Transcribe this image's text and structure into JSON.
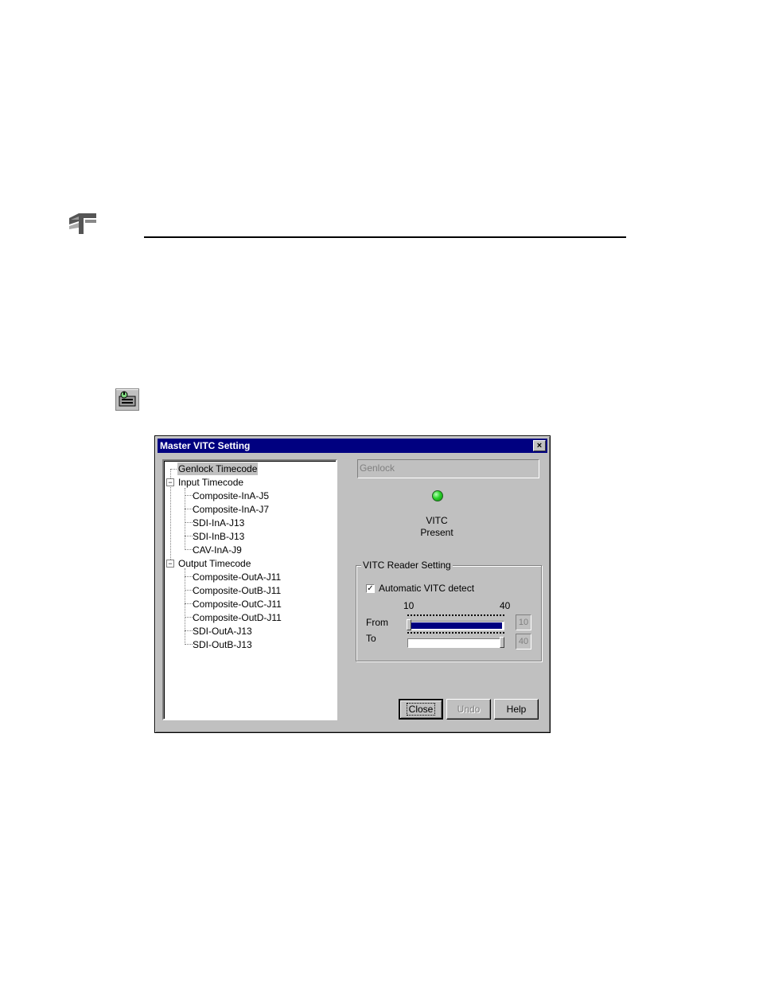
{
  "dialog": {
    "title": "Master VITC Setting",
    "close_glyph": "×",
    "source_field": "Genlock",
    "status_line1": "VITC",
    "status_line2": "Present",
    "led_color": "#2ad42a"
  },
  "tree": {
    "root_item": "Genlock Timecode",
    "input_group": "Input Timecode",
    "input_items": [
      "Composite-InA-J5",
      "Composite-InA-J7",
      "SDI-InA-J13",
      "SDI-InB-J13",
      "CAV-InA-J9"
    ],
    "output_group": "Output Timecode",
    "output_items": [
      "Composite-OutA-J11",
      "Composite-OutB-J11",
      "Composite-OutC-J11",
      "Composite-OutD-J11",
      "SDI-OutA-J13",
      "SDI-OutB-J13"
    ],
    "collapse_glyph": "−"
  },
  "reader": {
    "group_label": "VITC Reader Setting",
    "auto_detect_label": "Automatic VITC detect",
    "auto_detect_checked": "✓",
    "min_label": "10",
    "max_label": "40",
    "from_label": "From",
    "to_label": "To",
    "from_value": "10",
    "to_value": "40"
  },
  "buttons": {
    "close": "Close",
    "undo": "Undo",
    "help": "Help"
  },
  "icons": {
    "page_logo": "product-logo-icon",
    "tool": "configuration-tool-icon"
  }
}
